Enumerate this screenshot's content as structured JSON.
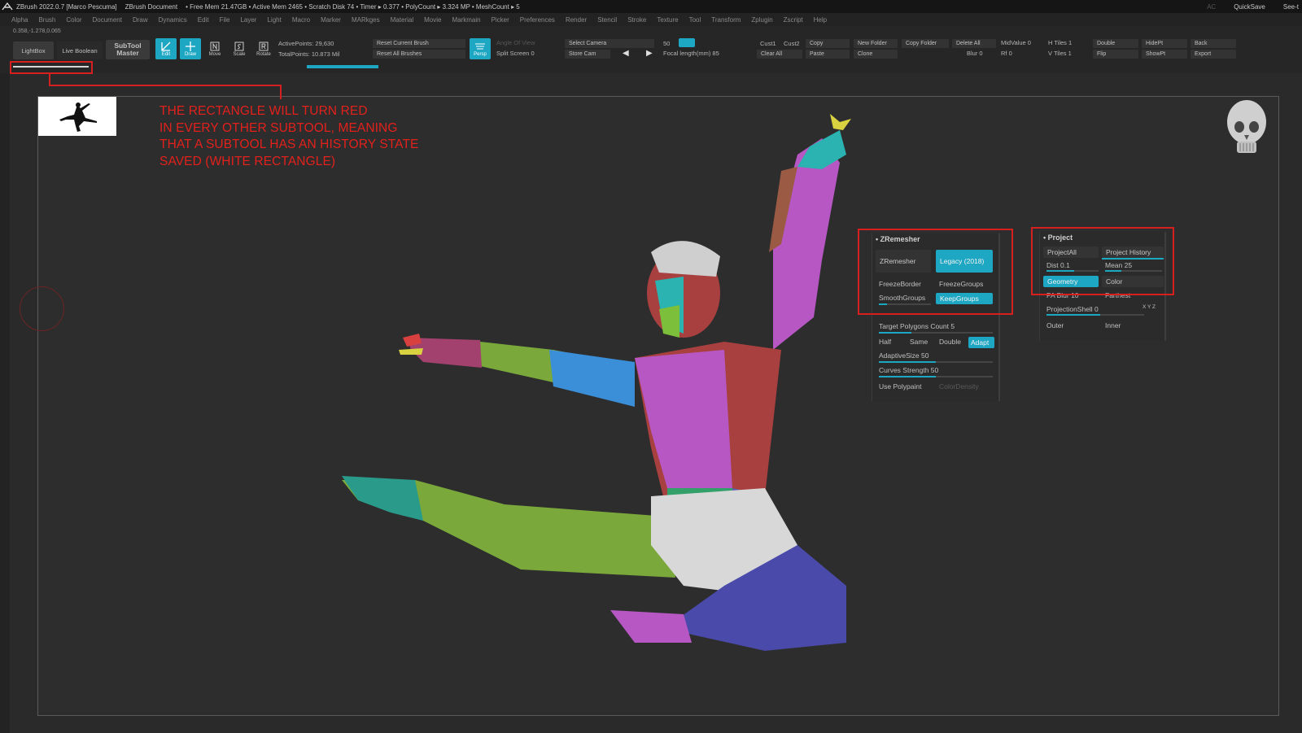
{
  "titlebar": {
    "app": "ZBrush 2022.0.7 [Marco Pescuma]",
    "doc": "ZBrush Document",
    "free_mem": "• Free Mem 21.47GB • Active Mem 2465 • Scratch Disk 74 • Timer ▸ 0.377 • PolyCount ▸ 3.324 MP • MeshCount ▸ 5",
    "ac": "AC",
    "quicksave": "QuickSave",
    "see": "See-t"
  },
  "menu": [
    "Alpha",
    "Brush",
    "Color",
    "Document",
    "Draw",
    "Dynamics",
    "Edit",
    "File",
    "Layer",
    "Light",
    "Macro",
    "Marker",
    "MARkges",
    "Material",
    "Movie",
    "Markmain",
    "Picker",
    "Preferences",
    "Render",
    "Stencil",
    "Stroke",
    "Texture",
    "Tool",
    "Transform",
    "Zplugin",
    "Zscript",
    "Help"
  ],
  "shelf": {
    "coords": "0.358,-1.278,0.065",
    "lightbox": "LightBox",
    "live_boolean": "Live Boolean",
    "subtool_master": "SubTool Master",
    "tools": [
      {
        "name": "edit",
        "label": "Edit"
      },
      {
        "name": "draw",
        "label": "Draw"
      },
      {
        "name": "move",
        "label": "Move"
      },
      {
        "name": "scale",
        "label": "Scale"
      },
      {
        "name": "rotate",
        "label": "Rotate"
      }
    ],
    "active_points": "ActivePoints: 29,630",
    "total_points": "TotalPoints: 10.873 Mil",
    "reset_current_brush": "Reset Current Brush",
    "reset_all_brushes": "Reset All Brushes",
    "persp": "Persp",
    "angle_of_view": "Angle Of View",
    "split_screen": "Split Screen 0",
    "select_camera": "Select Camera",
    "store_cam": "Store Cam",
    "val_50": "50",
    "focal_length": "Focal length(mm) 85",
    "cust1": "Cust1",
    "cust2": "Cust2",
    "copy": "Copy",
    "paste": "Paste",
    "clear_all": "Clear All",
    "new_folder": "New Folder",
    "clone": "Clone",
    "copy_folder": "Copy Folder",
    "delete_all": "Delete All",
    "midvalue": "MidValue 0",
    "blur": "Blur 0",
    "rf": "Rf 0",
    "h_tiles": "H Tiles 1",
    "v_tiles": "V Tiles 1",
    "double": "Double",
    "flip": "Flip",
    "hidept": "HidePt",
    "showpt": "ShowPt",
    "back": "Back",
    "export": "Export"
  },
  "annotation": {
    "lines": [
      "THE RECTANGLE WILL TURN RED",
      "IN EVERY OTHER SUBTOOL, MEANING",
      "THAT A SUBTOOL HAS AN HISTORY STATE",
      "SAVED (WHITE RECTANGLE)"
    ],
    "color": "#d6201f"
  },
  "zremesher": {
    "title": "ZRemesher",
    "zremesher_btn": "ZRemesher",
    "legacy_btn": "Legacy (2018)",
    "freeze_border": "FreezeBorder",
    "freeze_groups": "FreezeGroups",
    "smooth_groups": "SmoothGroups",
    "keep_groups": "KeepGroups",
    "target_polygons": "Target Polygons Count 5",
    "half": "Half",
    "same": "Same",
    "double": "Double",
    "adapt": "Adapt",
    "adaptive_size": "AdaptiveSize 50",
    "curves_strength": "Curves Strength 50",
    "use_polypaint": "Use Polypaint",
    "color_density": "ColorDensity"
  },
  "project": {
    "title": "Project",
    "project_all": "ProjectAll",
    "project_history": "Project History",
    "dist": "Dist 0.1",
    "mean": "Mean 25",
    "geometry": "Geometry",
    "color": "Color",
    "pa_blur": "PA Blur 10",
    "farthest": "Farthest",
    "projection_shell": "ProjectionShell 0",
    "xyz": "X Y Z",
    "outer": "Outer",
    "inner": "Inner"
  },
  "colors": {
    "accent": "#1ea7c3",
    "annotation_red": "#d6201f",
    "background": "#2d2d2d"
  }
}
